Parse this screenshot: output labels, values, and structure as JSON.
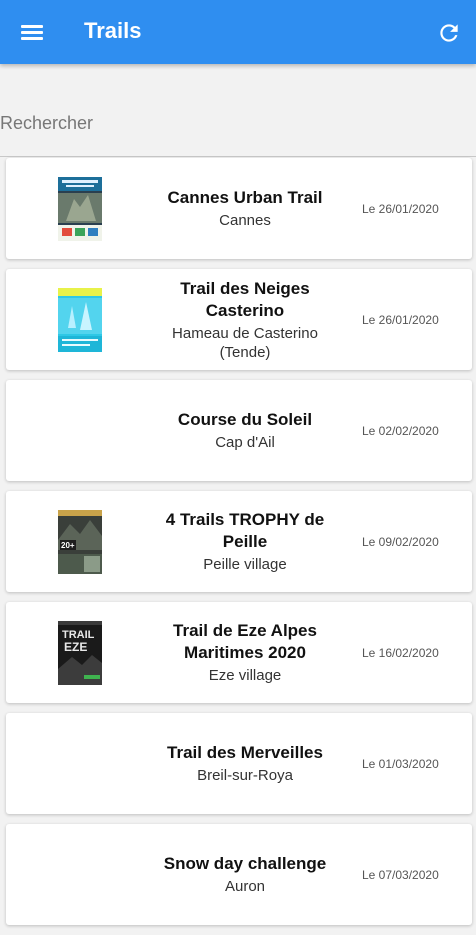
{
  "appbar": {
    "title": "Trails",
    "menu_icon": "menu-icon",
    "refresh_icon": "refresh-icon",
    "color": "#2f8ef0"
  },
  "search": {
    "placeholder": "Rechercher",
    "value": ""
  },
  "events": [
    {
      "name": "Cannes Urban Trail",
      "place": "Cannes",
      "date": "Le 26/01/2020",
      "thumb": "poster-cannes"
    },
    {
      "name": "Trail des Neiges Casterino",
      "place": "Hameau de Casterino (Tende)",
      "date": "Le 26/01/2020",
      "thumb": "poster-neiges"
    },
    {
      "name": "Course du Soleil",
      "place": "Cap d'Ail",
      "date": "Le 02/02/2020",
      "thumb": ""
    },
    {
      "name": "4 Trails TROPHY de Peille",
      "place": "Peille village",
      "date": "Le 09/02/2020",
      "thumb": "poster-peille"
    },
    {
      "name": "Trail de Eze Alpes Maritimes 2020",
      "place": "Eze village",
      "date": "Le 16/02/2020",
      "thumb": "poster-eze"
    },
    {
      "name": "Trail des Merveilles",
      "place": "Breil-sur-Roya",
      "date": "Le 01/03/2020",
      "thumb": ""
    },
    {
      "name": "Snow day challenge",
      "place": "Auron",
      "date": "Le 07/03/2020",
      "thumb": ""
    }
  ],
  "posters": {
    "poster-cannes": {
      "words": []
    },
    "poster-neiges": {
      "words": []
    },
    "poster-peille": {
      "words": [
        "20+"
      ]
    },
    "poster-eze": {
      "words": [
        "TRAIL",
        "EZE"
      ]
    }
  }
}
